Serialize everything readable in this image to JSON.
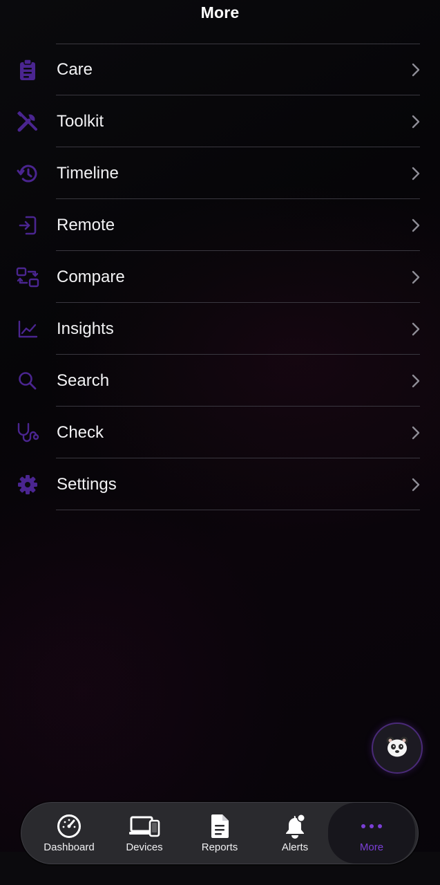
{
  "header": {
    "title": "More"
  },
  "menu": {
    "items": [
      {
        "label": "Care",
        "icon": "clipboard-icon"
      },
      {
        "label": "Toolkit",
        "icon": "tools-icon"
      },
      {
        "label": "Timeline",
        "icon": "history-icon"
      },
      {
        "label": "Remote",
        "icon": "sign-in-icon"
      },
      {
        "label": "Compare",
        "icon": "compare-icon"
      },
      {
        "label": "Insights",
        "icon": "chart-line-icon"
      },
      {
        "label": "Search",
        "icon": "search-icon"
      },
      {
        "label": "Check",
        "icon": "stethoscope-icon"
      },
      {
        "label": "Settings",
        "icon": "gear-icon"
      }
    ]
  },
  "assistant": {
    "icon": "panda-face-icon",
    "glyph": "🐻‍❄️"
  },
  "tabbar": {
    "tabs": [
      {
        "label": "Dashboard",
        "icon": "speedometer-icon"
      },
      {
        "label": "Devices",
        "icon": "devices-icon"
      },
      {
        "label": "Reports",
        "icon": "document-icon"
      },
      {
        "label": "Alerts",
        "icon": "bell-badge-icon"
      },
      {
        "label": "More",
        "icon": "ellipsis-icon"
      }
    ],
    "active": "More"
  },
  "colors": {
    "accent": "#7b3fd6",
    "icon_purple": "#4a2590",
    "background": "#050408",
    "tabbar_bg": "#2a2a2e"
  }
}
